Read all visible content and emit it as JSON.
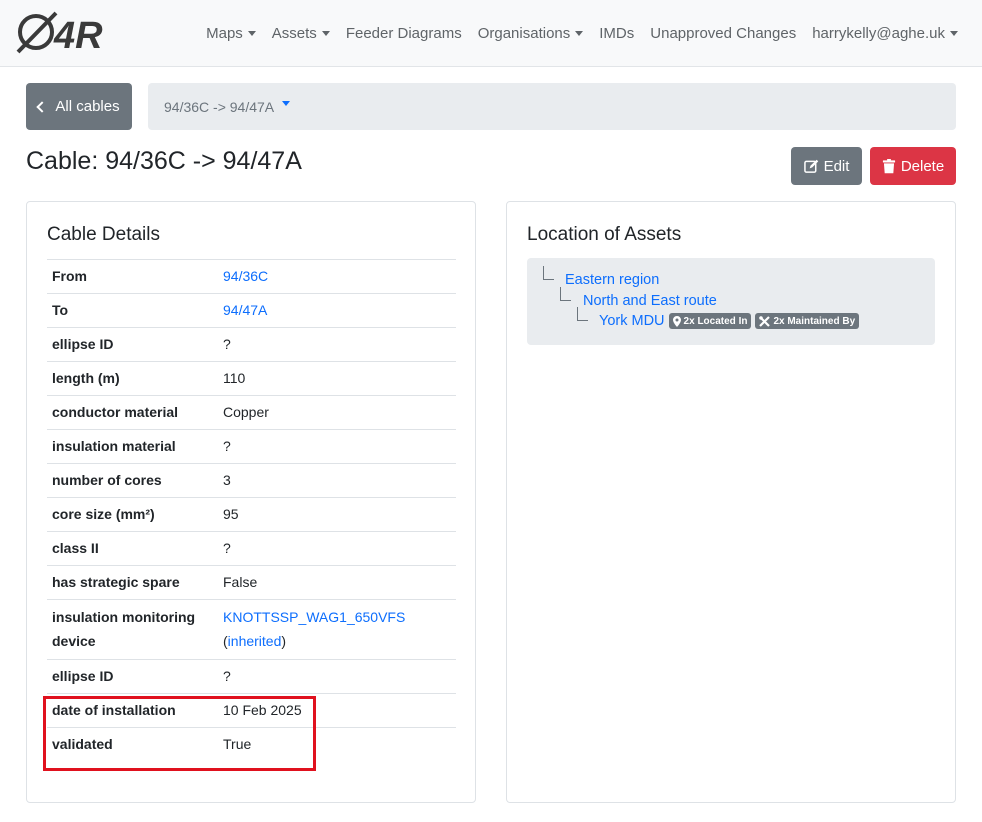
{
  "navbar": {
    "logo_text": "Ø4R",
    "items": [
      {
        "label": "Maps",
        "dropdown": true
      },
      {
        "label": "Assets",
        "dropdown": true
      },
      {
        "label": "Feeder Diagrams",
        "dropdown": false
      },
      {
        "label": "Organisations",
        "dropdown": true
      },
      {
        "label": "IMDs",
        "dropdown": false
      },
      {
        "label": "Unapproved Changes",
        "dropdown": false
      },
      {
        "label": "harrykelly@aghe.uk",
        "dropdown": true
      }
    ]
  },
  "back_button": {
    "label": "All cables"
  },
  "selector": {
    "value": "94/36C -> 94/47A"
  },
  "page": {
    "title": "Cable: 94/36C -> 94/47A"
  },
  "actions": {
    "edit_label": "Edit",
    "delete_label": "Delete"
  },
  "details_card": {
    "title": "Cable Details",
    "rows": [
      {
        "key": "From",
        "value": "94/36C",
        "link": true
      },
      {
        "key": "To",
        "value": "94/47A",
        "link": true
      },
      {
        "key": "ellipse ID",
        "value": "?"
      },
      {
        "key": "length (m)",
        "value": "110"
      },
      {
        "key": "conductor material",
        "value": "Copper"
      },
      {
        "key": "insulation material",
        "value": "?"
      },
      {
        "key": "number of cores",
        "value": "3"
      },
      {
        "key": "core size (mm²)",
        "value": "95"
      },
      {
        "key": "class II",
        "value": "?"
      },
      {
        "key": "has strategic spare",
        "value": "False"
      },
      {
        "key": "insulation monitoring device",
        "value": "KNOTTSSP_WAG1_650VFS",
        "link": true,
        "sub_prefix": "(",
        "sub_link": "inherited",
        "sub_suffix": ")"
      },
      {
        "key": "ellipse ID",
        "value": "?"
      },
      {
        "key": "date of installation",
        "value": "10 Feb 2025"
      },
      {
        "key": "validated",
        "value": "True"
      }
    ]
  },
  "location_card": {
    "title": "Location of Assets",
    "tree": [
      {
        "label": "Eastern region"
      },
      {
        "label": "North and East route"
      },
      {
        "label": "York MDU",
        "badges": [
          {
            "label": "2x Located In",
            "icon": "map-pin-icon"
          },
          {
            "label": "2x Maintained By",
            "icon": "tools-icon"
          }
        ]
      }
    ]
  },
  "colors": {
    "primary": "#0d6efd",
    "secondary": "#6c757d",
    "danger": "#dc3545",
    "highlight": "#e0111e"
  }
}
